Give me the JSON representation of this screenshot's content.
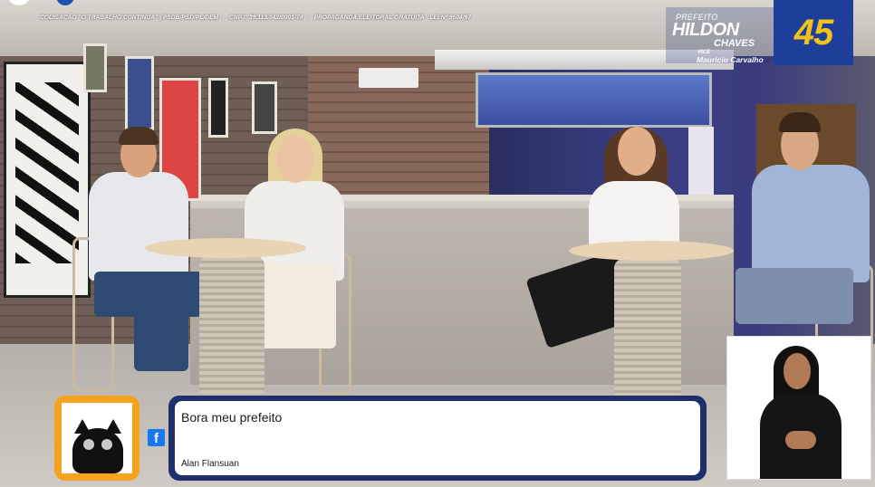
{
  "overlay": {
    "coalition_label": "COLIGAÇÃO \"O TRABALHO CONTINUA\" | PSDB/PSD/PL/DEM",
    "cnpj_text": "CNPJ: 39.113.042/0001-74",
    "disclaimer_text": "PROPAGANDA ELEITORAL GRATUITA - LEI Nº 9504/97",
    "separator": "-"
  },
  "brand": {
    "office": "PREFEITO",
    "name_first": "HILDON",
    "name_last": "CHAVES",
    "vice_label": "VICE",
    "vice_name": "Maurício Carvalho",
    "candidate_number": "45",
    "accent_color": "#f2c21a",
    "badge_color": "#1d3f9a"
  },
  "comment": {
    "text": "Bora meu prefeito",
    "author": "Alan Flansuan",
    "platform_icon": "facebook-icon",
    "platform_glyph": "f",
    "frame_color": "#f3a31c",
    "card_color": "#1e2f6b"
  },
  "sign_language": {
    "icon": "interpreter-video"
  }
}
